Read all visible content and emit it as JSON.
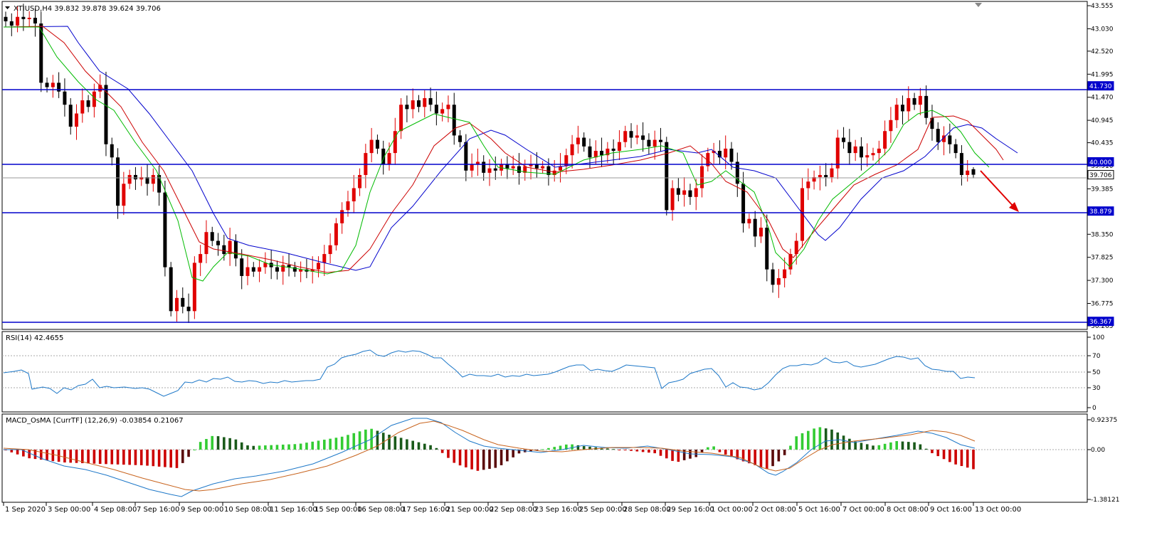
{
  "header": {
    "main": "XTIUSD,H4  39.832 39.878 39.624 39.706",
    "rsi": "RSI(14) 42.4655",
    "macd": "MACD_OsMA [CurrTF] (12,26,9) -0.03854 0.21067"
  },
  "price_scale": [
    "43.555",
    "43.030",
    "42.520",
    "41.995",
    "41.470",
    "40.945",
    "40.435",
    "39.910",
    "39.385",
    "38.350",
    "37.825",
    "37.300",
    "36.775",
    "36.265"
  ],
  "level_tags": [
    {
      "label": "41.730",
      "value": 41.73,
      "style": "blue"
    },
    {
      "label": "40.000",
      "value": 40.0,
      "style": "blue"
    },
    {
      "label": "39.706",
      "value": 39.706,
      "style": "current"
    },
    {
      "label": "38.879",
      "value": 38.879,
      "style": "blue"
    },
    {
      "label": "36.367",
      "value": 36.367,
      "style": "blue"
    }
  ],
  "rsi_scale": [
    "100",
    "70",
    "50",
    "30",
    "0"
  ],
  "macd_scale": [
    "0.92375",
    "0.00",
    "-1.38121"
  ],
  "time_labels": [
    "1 Sep 2020",
    "3 Sep 00:00",
    "4 Sep 08:00",
    "7 Sep 16:00",
    "9 Sep 00:00",
    "10 Sep 08:00",
    "11 Sep 16:00",
    "15 Sep 00:00",
    "16 Sep 08:00",
    "17 Sep 16:00",
    "21 Sep 00:00",
    "22 Sep 08:00",
    "23 Sep 16:00",
    "25 Sep 00:00",
    "28 Sep 08:00",
    "29 Sep 16:00",
    "1 Oct 00:00",
    "2 Oct 08:00",
    "5 Oct 16:00",
    "7 Oct 00:00",
    "8 Oct 08:00",
    "9 Oct 16:00",
    "13 Oct 00:00"
  ],
  "colors": {
    "bull": "#e00000",
    "bear": "#000000",
    "level": "#0000cc",
    "ma_fast": "#00bb00",
    "ma_mid": "#cc0000",
    "ma_slow": "#0000cc",
    "rsi": "#1e78c8",
    "macd_pos": "#33cc33",
    "macd_neg": "#cc0000",
    "signal": "#c8641e"
  },
  "chart_data": {
    "type": "candlestick",
    "symbol": "XTIUSD",
    "timeframe": "H4",
    "last_ohlc": {
      "open": 39.832,
      "high": 39.878,
      "low": 39.624,
      "close": 39.706
    },
    "ylim": [
      36.265,
      43.555
    ],
    "closes": [
      43.2,
      43.1,
      43.3,
      43.25,
      43.28,
      43.15,
      41.8,
      41.7,
      41.8,
      41.6,
      41.3,
      40.8,
      41.1,
      41.4,
      41.25,
      41.6,
      41.75,
      40.4,
      40.1,
      39.0,
      39.5,
      39.7,
      39.6,
      39.65,
      39.5,
      39.7,
      39.3,
      37.6,
      36.6,
      36.9,
      36.7,
      36.6,
      37.7,
      37.9,
      38.4,
      38.2,
      38.1,
      37.9,
      38.2,
      37.8,
      37.4,
      37.6,
      37.5,
      37.6,
      37.7,
      37.6,
      37.5,
      37.65,
      37.6,
      37.5,
      37.55,
      37.5,
      37.55,
      37.7,
      37.9,
      38.1,
      38.6,
      38.9,
      39.1,
      39.4,
      39.7,
      40.2,
      40.5,
      40.3,
      39.95,
      40.2,
      40.7,
      41.3,
      41.2,
      41.4,
      41.25,
      41.45,
      41.3,
      41.1,
      41.2,
      41.3,
      40.6,
      40.45,
      39.8,
      39.95,
      40.0,
      39.75,
      39.85,
      39.8,
      39.95,
      39.85,
      39.9,
      39.75,
      39.9,
      39.95,
      39.85,
      39.9,
      39.7,
      39.8,
      39.9,
      40.15,
      40.4,
      40.55,
      40.35,
      40.1,
      40.25,
      40.15,
      40.3,
      40.25,
      40.45,
      40.7,
      40.55,
      40.6,
      40.5,
      40.35,
      40.5,
      40.45,
      38.9,
      39.4,
      39.25,
      39.35,
      39.2,
      39.4,
      39.9,
      40.2,
      40.25,
      40.1,
      40.3,
      40.0,
      39.5,
      38.6,
      38.7,
      38.3,
      38.5,
      37.55,
      37.2,
      37.35,
      37.55,
      37.9,
      38.2,
      39.4,
      39.55,
      39.65,
      39.7,
      39.65,
      39.85,
      40.55,
      40.45,
      40.2,
      40.35,
      40.1,
      40.15,
      40.2,
      40.3,
      40.7,
      40.95,
      41.3,
      41.15,
      41.45,
      41.3,
      41.5,
      41.0,
      40.75,
      40.45,
      40.6,
      40.4,
      40.2,
      39.7,
      39.8,
      39.706
    ]
  }
}
